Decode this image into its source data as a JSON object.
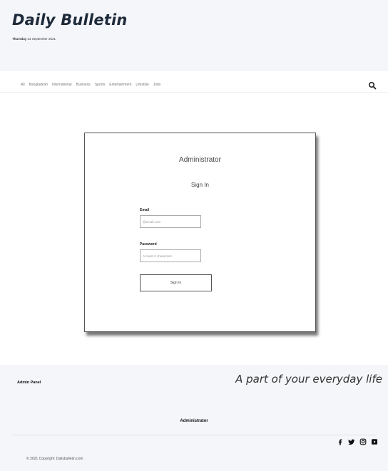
{
  "header": {
    "logo": "Daily Bulletin",
    "weekday": "Thursday",
    "date": "23 September 2021"
  },
  "nav": {
    "items": [
      "All",
      "Bangladesh",
      "International",
      "Business",
      "Sports",
      "Entertainment",
      "Lifestyle",
      "Jobs"
    ],
    "search_icon": "search-icon"
  },
  "login": {
    "title": "Administrator",
    "subtitle": "Sign In",
    "email_label": "Email",
    "email_placeholder": "@email.com",
    "password_label": "Password",
    "password_placeholder": "At least 6 characters",
    "submit_label": "Sign In"
  },
  "footer": {
    "admin_panel": "Admin Panel",
    "tagline": "A part of your everyday life",
    "admin_link": "Administrator",
    "copyright": "© 2021 Copyright: Dailybulletin.com",
    "social_icons": [
      "facebook-icon",
      "twitter-icon",
      "instagram-icon",
      "youtube-icon"
    ]
  },
  "colors": {
    "header_bg": "#f4f6f9",
    "footer_bg": "#f4f6f9",
    "logo_text": "#1e2a3a",
    "card_border": "#555555"
  }
}
